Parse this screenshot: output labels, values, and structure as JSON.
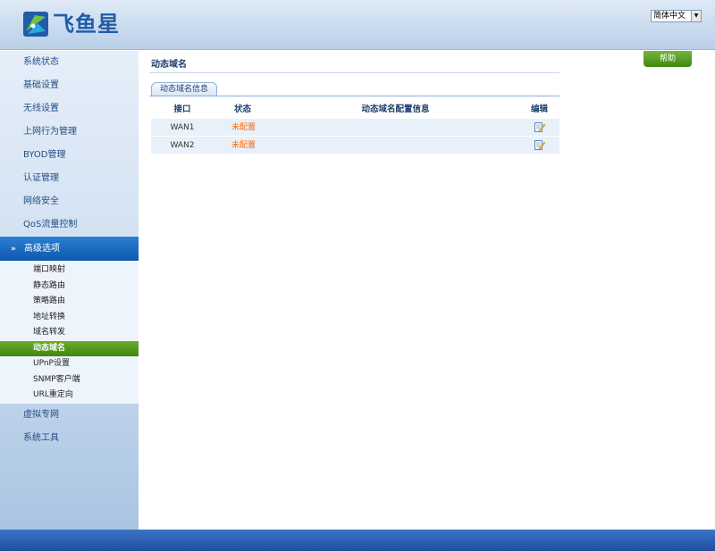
{
  "header": {
    "logo_text": "飞鱼星",
    "language": "简体中文"
  },
  "sidebar": {
    "items": [
      {
        "label": "系统状态"
      },
      {
        "label": "基础设置"
      },
      {
        "label": "无线设置"
      },
      {
        "label": "上网行为管理"
      },
      {
        "label": "BYOD管理"
      },
      {
        "label": "认证管理"
      },
      {
        "label": "网络安全"
      },
      {
        "label": "QoS流量控制"
      }
    ],
    "expanded": {
      "label": "高级选项",
      "sub_items": [
        {
          "label": "端口映射"
        },
        {
          "label": "静态路由"
        },
        {
          "label": "策略路由"
        },
        {
          "label": "地址转换"
        },
        {
          "label": "域名转发"
        },
        {
          "label": "动态域名",
          "active": true
        },
        {
          "label": "UPnP设置"
        },
        {
          "label": "SNMP客户端"
        },
        {
          "label": "URL重定向"
        }
      ]
    },
    "items_after": [
      {
        "label": "虚拟专网"
      },
      {
        "label": "系统工具"
      }
    ]
  },
  "main": {
    "page_title": "动态域名",
    "help_label": "帮助",
    "tab_label": "动态域名信息",
    "columns": [
      "接口",
      "状态",
      "动态域名配置信息",
      "编辑"
    ],
    "rows": [
      {
        "interface": "WAN1",
        "status": "未配置",
        "config": "",
        "edit_icon": "edit-icon"
      },
      {
        "interface": "WAN2",
        "status": "未配置",
        "config": "",
        "edit_icon": "edit-icon"
      }
    ]
  },
  "colors": {
    "active_green": "#4f9a1c",
    "status_orange": "#ff6600",
    "brand_blue": "#1f5da8"
  }
}
